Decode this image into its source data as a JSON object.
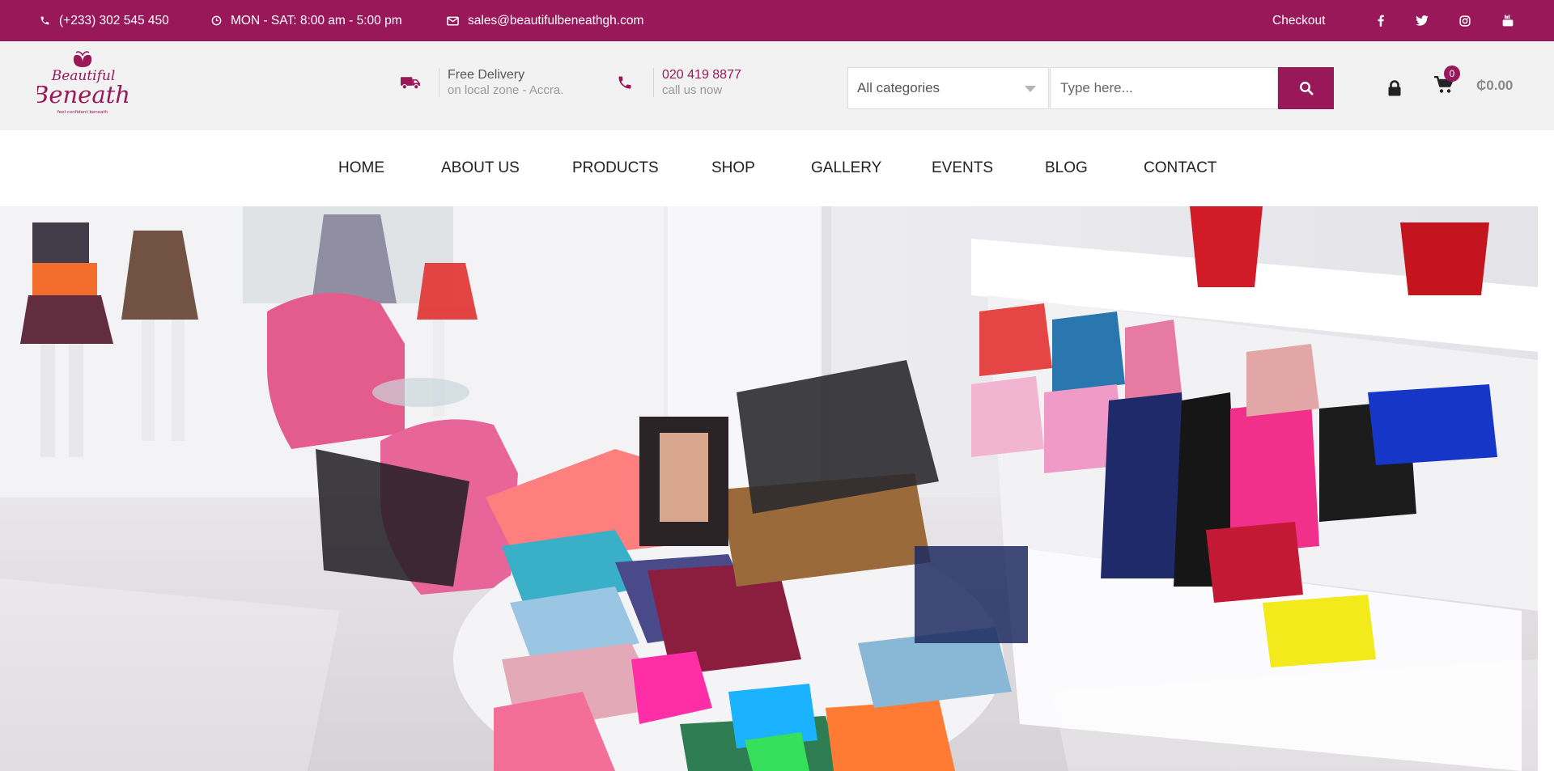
{
  "topbar": {
    "phone": "(+233) 302 545 450",
    "hours": "MON - SAT: 8:00 am - 5:00 pm",
    "email": "sales@beautifulbeneathgh.com",
    "checkout": "Checkout",
    "social": [
      "facebook-icon",
      "twitter-icon",
      "instagram-icon",
      "youtube-icon"
    ]
  },
  "header": {
    "logo_text": "Beautiful Beneath",
    "logo_tagline": "feel confident beneath",
    "delivery_title": "Free Delivery",
    "delivery_sub": "on local zone - Accra.",
    "call_number": "020 419 8877",
    "call_sub": "call us now",
    "category_select": "All categories",
    "search_placeholder": "Type here...",
    "cart_count": "0",
    "cart_total": "₵0.00"
  },
  "nav": {
    "items": [
      "HOME",
      "ABOUT US",
      "PRODUCTS",
      "SHOP",
      "GALLERY",
      "EVENTS",
      "BLOG",
      "CONTACT"
    ]
  },
  "colors": {
    "brand": "#98185a",
    "header_bg": "#f2f2f2"
  }
}
